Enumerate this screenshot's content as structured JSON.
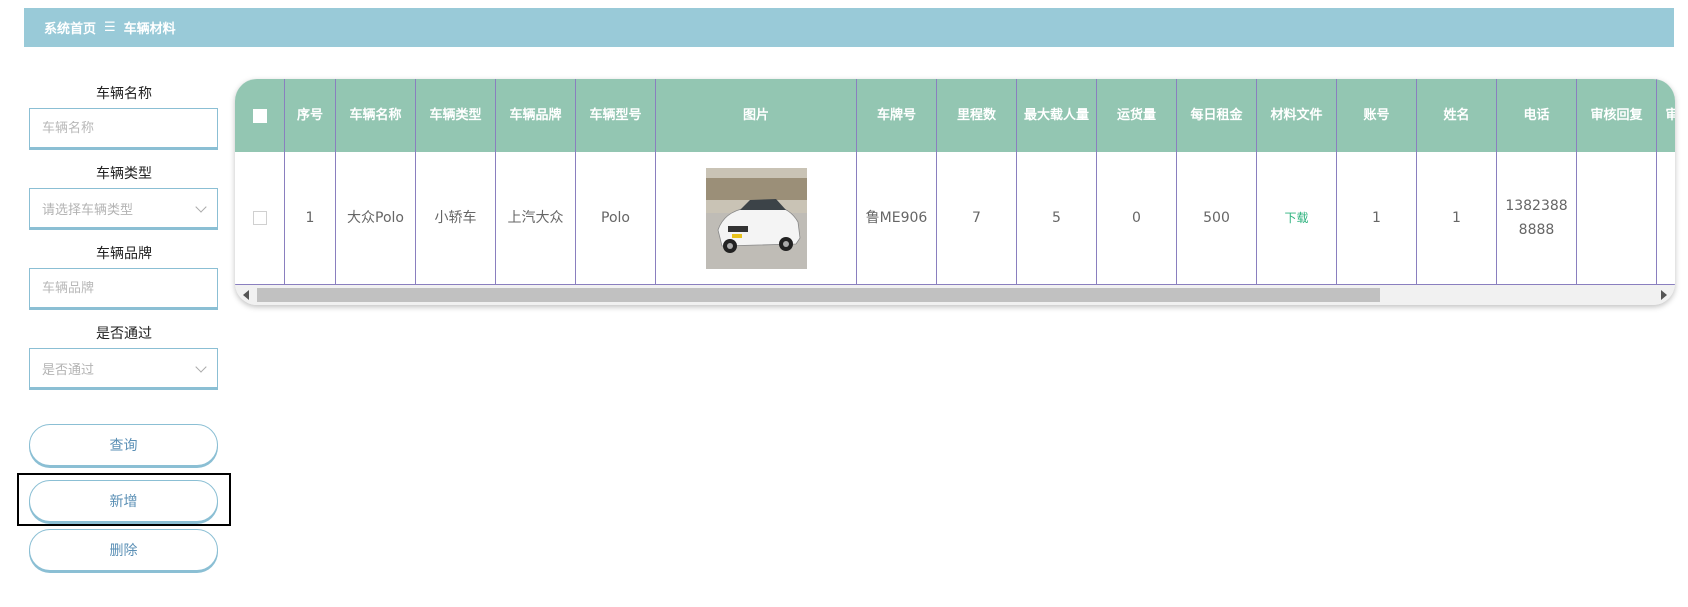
{
  "breadcrumb": {
    "home": "系统首页",
    "separator": "☰",
    "current": "车辆材料"
  },
  "search": {
    "vehicle_name": {
      "label": "车辆名称",
      "placeholder": "车辆名称"
    },
    "vehicle_type": {
      "label": "车辆类型",
      "placeholder": "请选择车辆类型"
    },
    "vehicle_brand": {
      "label": "车辆品牌",
      "placeholder": "车辆品牌"
    },
    "approved": {
      "label": "是否通过",
      "placeholder": "是否通过"
    }
  },
  "buttons": {
    "query": "查询",
    "add": "新增",
    "delete": "删除"
  },
  "table": {
    "headers": {
      "seq": "序号",
      "name": "车辆名称",
      "type": "车辆类型",
      "brand": "车辆品牌",
      "model": "车辆型号",
      "image": "图片",
      "plate": "车牌号",
      "mileage": "里程数",
      "max_passengers": "最大载人量",
      "cargo": "运货量",
      "daily_rent": "每日租金",
      "file": "材料文件",
      "account": "账号",
      "real_name": "姓名",
      "phone": "电话",
      "review_reply": "审核回复",
      "more": "审"
    },
    "rows": [
      {
        "seq": "1",
        "name": "大众Polo",
        "type": "小轿车",
        "brand": "上汽大众",
        "model": "Polo",
        "image": "white-hatchback-car-photo",
        "plate": "鲁ME906",
        "mileage": "7",
        "max_passengers": "5",
        "cargo": "0",
        "daily_rent": "500",
        "file": "下载",
        "account": "1",
        "real_name": "1",
        "phone": "13823888888",
        "review_reply": "",
        "more": ""
      }
    ]
  },
  "colors": {
    "breadcrumb_bg": "#99cad8",
    "table_header_bg": "#93c6b2",
    "border_accent": "#8bbfd4",
    "download_link": "#2fb37f"
  }
}
